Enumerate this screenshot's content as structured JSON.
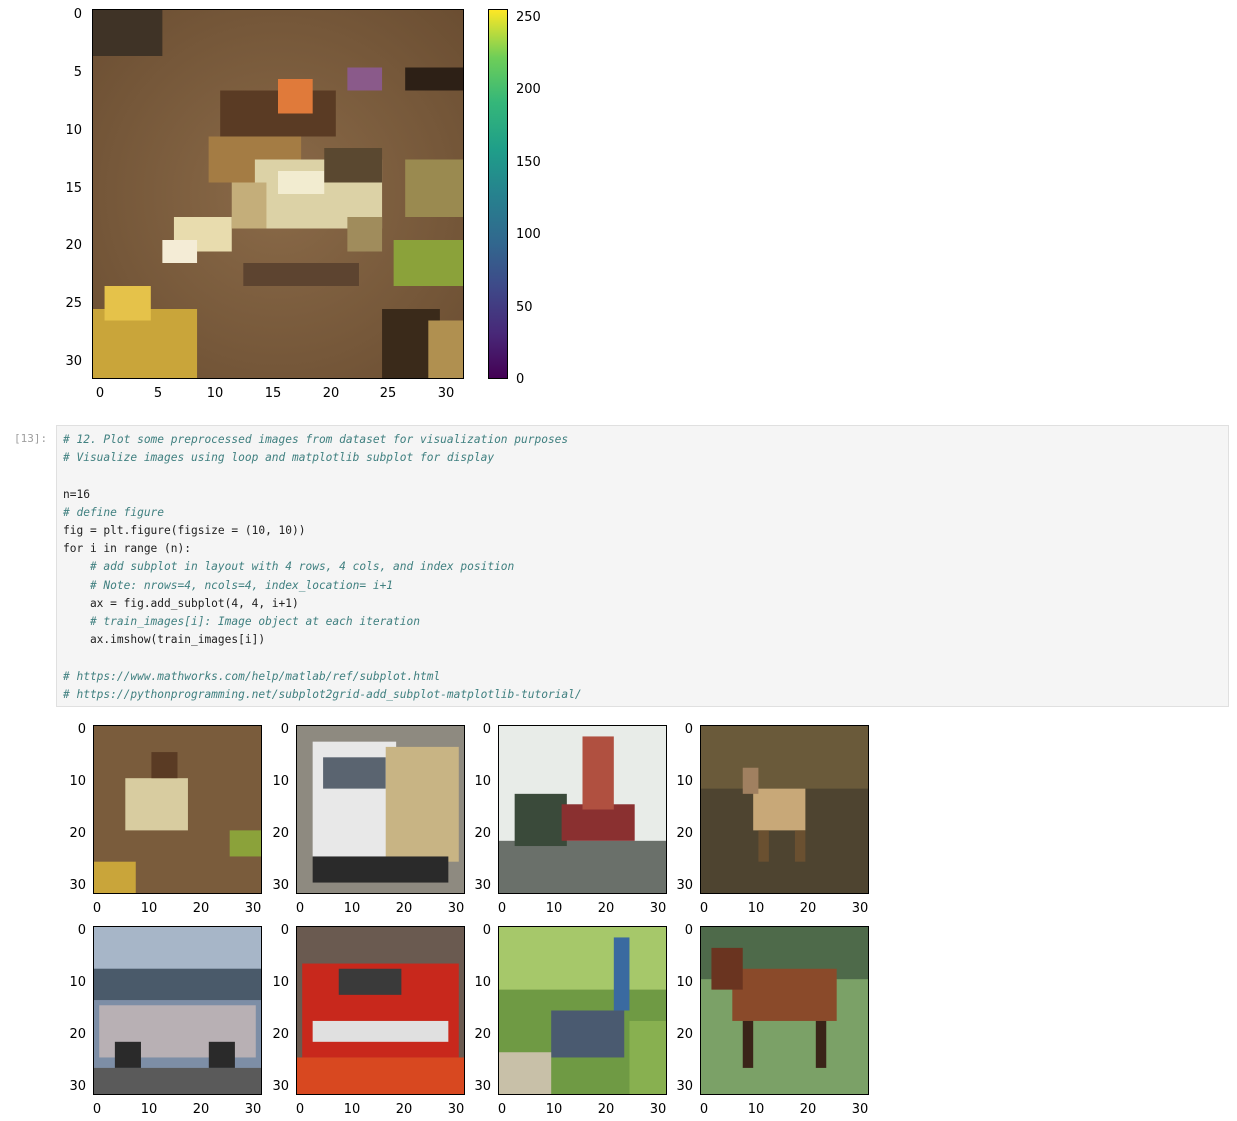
{
  "top_plot": {
    "y_ticks": [
      "0",
      "5",
      "10",
      "15",
      "20",
      "25",
      "30"
    ],
    "x_ticks": [
      "0",
      "5",
      "10",
      "15",
      "20",
      "25",
      "30"
    ],
    "image_icon": "frog-pixel-image"
  },
  "colorbar": {
    "ticks": [
      "250",
      "200",
      "150",
      "100",
      "50",
      "0"
    ],
    "colormap": "viridis",
    "colors": [
      "#440154",
      "#3b528b",
      "#21918c",
      "#5ec962",
      "#fde725"
    ]
  },
  "code_cell": {
    "prompt": "[13]:",
    "lines": [
      "# 12. Plot some preprocessed images from dataset for visualization purposes",
      "# Visualize images using loop and matplotlib subplot for display",
      "",
      "n=16",
      "# define figure",
      "fig = plt.figure(figsize = (10, 10))",
      "for i in range (n):",
      "    # add subplot in layout with 4 rows, 4 cols, and index position",
      "    # Note: nrows=4, ncols=4, index_location= i+1",
      "    ax = fig.add_subplot(4, 4, i+1)",
      "    # train_images[i]: Image object at each iteration",
      "    ax.imshow(train_images[i])",
      "",
      "# https://www.mathworks.com/help/matlab/ref/subplot.html",
      "# https://pythonprogramming.net/subplot2grid-add_subplot-matplotlib-tutorial/"
    ]
  },
  "grid": {
    "y_ticks": [
      "0",
      "10",
      "20",
      "30"
    ],
    "x_ticks": [
      "0",
      "10",
      "20",
      "30"
    ],
    "images": [
      {
        "icon": "frog-image",
        "bg": "#7a5c3c"
      },
      {
        "icon": "truck-image",
        "bg": "#b8b8b8"
      },
      {
        "icon": "dump-truck-image",
        "bg": "#d8dcd8"
      },
      {
        "icon": "deer-image",
        "bg": "#5a4e34"
      },
      {
        "icon": "car-image",
        "bg": "#7d8ea6"
      },
      {
        "icon": "red-car-image",
        "bg": "#b83222"
      },
      {
        "icon": "bird-image",
        "bg": "#6f9a44"
      },
      {
        "icon": "horse-image",
        "bg": "#7ba167"
      }
    ]
  }
}
